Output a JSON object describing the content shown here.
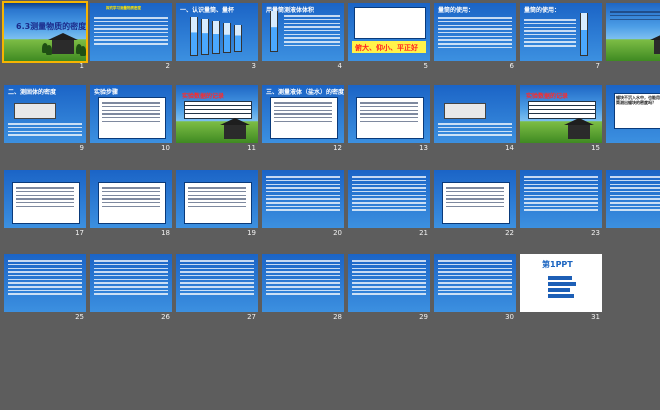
{
  "slides": [
    {
      "n": "1",
      "title": "6.3测量物质的密度",
      "theme": "meadow",
      "kind": "title"
    },
    {
      "n": "2",
      "title": "",
      "theme": "blue",
      "kind": "text",
      "caption": "探究学习测量物质密度"
    },
    {
      "n": "3",
      "title": "一、认识量筒、量杯",
      "theme": "blue",
      "kind": "cylinders"
    },
    {
      "n": "4",
      "title": "用量筒测液体体积",
      "theme": "blue",
      "kind": "cylinder-text"
    },
    {
      "n": "5",
      "title": "",
      "theme": "blue",
      "kind": "eyes",
      "caption": "俯大、仰小、平正好"
    },
    {
      "n": "6",
      "title": "量筒的使用：",
      "theme": "blue",
      "kind": "text-red"
    },
    {
      "n": "7",
      "title": "量筒的使用：",
      "theme": "blue",
      "kind": "cylinder-side"
    },
    {
      "n": "8",
      "title": "",
      "theme": "meadow",
      "kind": "labels"
    },
    {
      "n": "9",
      "title": "二、测固体的密度",
      "theme": "blue",
      "kind": "balance"
    },
    {
      "n": "10",
      "title": "实验步骤",
      "theme": "blue",
      "kind": "steps"
    },
    {
      "n": "11",
      "title": "实验数据的记录",
      "theme": "meadow",
      "kind": "table"
    },
    {
      "n": "12",
      "title": "三、测量液体（盐水）的密度",
      "theme": "blue",
      "kind": "apparatus"
    },
    {
      "n": "13",
      "title": "",
      "theme": "blue",
      "kind": "text-panel"
    },
    {
      "n": "14",
      "title": "",
      "theme": "blue",
      "kind": "balance-text"
    },
    {
      "n": "15",
      "title": "实验数据的记录",
      "theme": "meadow",
      "kind": "table2"
    },
    {
      "n": "16",
      "title": "",
      "theme": "blue",
      "kind": "question",
      "caption": "蜡块不沉入水中，也能用天平和量筒测出蜡块的密度吗？"
    },
    {
      "n": "17",
      "title": "",
      "theme": "blue",
      "kind": "question-list"
    },
    {
      "n": "18",
      "title": "",
      "theme": "blue",
      "kind": "question-list2"
    },
    {
      "n": "19",
      "title": "",
      "theme": "blue",
      "kind": "beaker"
    },
    {
      "n": "20",
      "title": "",
      "theme": "blue",
      "kind": "text-long"
    },
    {
      "n": "21",
      "title": "",
      "theme": "blue",
      "kind": "text-long2"
    },
    {
      "n": "22",
      "title": "",
      "theme": "blue",
      "kind": "ruler"
    },
    {
      "n": "23",
      "title": "",
      "theme": "blue",
      "kind": "text-long3"
    },
    {
      "n": "24",
      "title": "",
      "theme": "blue",
      "kind": "text-long4"
    },
    {
      "n": "25",
      "title": "",
      "theme": "blue",
      "kind": "text-long5"
    },
    {
      "n": "26",
      "title": "",
      "theme": "blue",
      "kind": "text-long6"
    },
    {
      "n": "27",
      "title": "",
      "theme": "blue",
      "kind": "text-long7"
    },
    {
      "n": "28",
      "title": "",
      "theme": "blue",
      "kind": "text-long8"
    },
    {
      "n": "29",
      "title": "",
      "theme": "blue",
      "kind": "text-long9"
    },
    {
      "n": "30",
      "title": "",
      "theme": "blue",
      "kind": "text-long10"
    },
    {
      "n": "31",
      "title": "",
      "theme": "ppt",
      "kind": "ppt",
      "logo": "第1PPT"
    }
  ],
  "selected": "1"
}
